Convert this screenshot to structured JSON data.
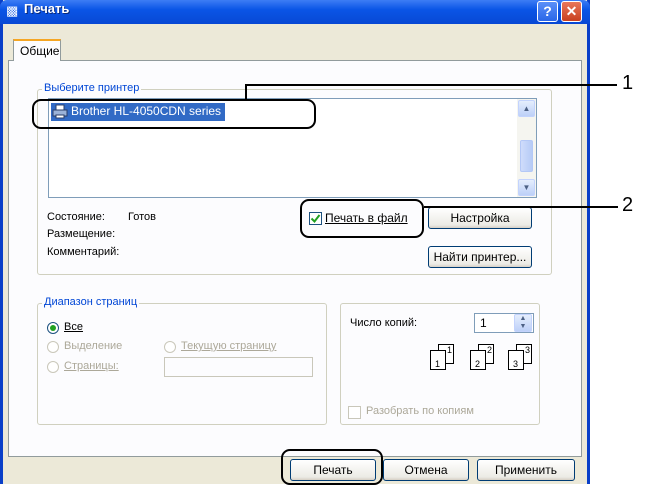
{
  "window": {
    "title": "Печать",
    "help_label": "?",
    "close_label": "✕"
  },
  "tab": {
    "label": "Общие"
  },
  "printer_group": {
    "legend": "Выберите принтер",
    "selected_printer": "Brother HL-4050CDN series",
    "status_label": "Состояние:",
    "status_value": "Готов",
    "location_label": "Размещение:",
    "comment_label": "Комментарий:",
    "print_to_file_label": "Печать в файл",
    "print_to_file_checked": true,
    "settings_button": "Настройка",
    "find_printer_button": "Найти принтер..."
  },
  "page_range": {
    "legend": "Диапазон страниц",
    "all_label": "Все",
    "all_selected": true,
    "selection_label": "Выделение",
    "current_page_label": "Текущую страницу",
    "pages_label": "Страницы:",
    "pages_value": ""
  },
  "copies": {
    "label": "Число копий:",
    "value": "1",
    "collate_label": "Разобрать по копиям",
    "collate_checked": false,
    "page_icons": [
      "1",
      "1",
      "2",
      "2",
      "3",
      "3"
    ]
  },
  "footer": {
    "print_button": "Печать",
    "cancel_button": "Отмена",
    "apply_button": "Применить"
  },
  "callouts": {
    "one": "1",
    "two": "2"
  },
  "colors": {
    "title_bar": "#0a55e6",
    "selection": "#316ac5",
    "group_label": "#0046d5",
    "close_button": "#c8401f"
  }
}
